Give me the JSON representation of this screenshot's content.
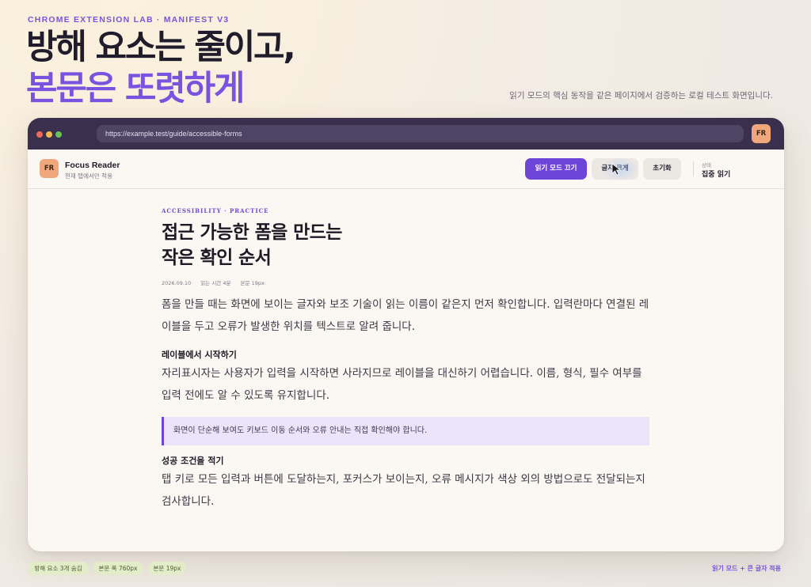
{
  "eyebrow": "CHROME EXTENSION LAB · MANIFEST V3",
  "hero": {
    "line1": "방해 요소는 줄이고,",
    "line2": "본문은 또렷하게",
    "subtitle": "읽기 모드의 핵심 동작을 같은 페이지에서 검증하는 로컬 테스트 화면입니다."
  },
  "browser": {
    "url": "https://example.test/guide/accessible-forms",
    "extension_badge": "FR"
  },
  "toolbar": {
    "logo": "FR",
    "app_name": "Focus Reader",
    "app_scope": "현재 탭에서만 적용",
    "reader_toggle_label": "읽기 모드 끄기",
    "font_size_label": "글자 크게",
    "reset_label": "초기화",
    "state_label": "상태",
    "state_value": "집중 읽기"
  },
  "article": {
    "kicker": "ACCESSIBILITY · PRACTICE",
    "title_line1": "접근 가능한 폼을 만드는",
    "title_line2": "작은 확인 순서",
    "meta": {
      "date": "2026.09.10",
      "read_time": "읽는 시간 4분",
      "font_size": "본문 19px"
    },
    "intro": "폼을 만들 때는 화면에 보이는 글자와 보조 기술이 읽는 이름이 같은지 먼저 확인합니다. 입력란마다 연결된 레이블을 두고 오류가 발생한 위치를 텍스트로 알려 줍니다.",
    "section1_heading": "레이블에서 시작하기",
    "section1_body": "자리표시자는 사용자가 입력을 시작하면 사라지므로 레이블을 대신하기 어렵습니다. 이름, 형식, 필수 여부를 입력 전에도 알 수 있도록 유지합니다.",
    "callout": "화면이 단순해 보여도 키보드 이동 순서와 오류 안내는 직접 확인해야 합니다.",
    "section2_heading": "성공 조건을 적기",
    "section2_body": "탭 키로 모든 입력과 버튼에 도달하는지, 포커스가 보이는지, 오류 메시지가 색상 외의 방법으로도 전달되는지 검사합니다."
  },
  "footer": {
    "chips": [
      "방해 요소 3개 숨김",
      "본문 폭 760px",
      "본문 19px"
    ],
    "status": "읽기 모드 + 큰 글자 적용"
  },
  "colors": {
    "accent": "#6e45d9",
    "chrome": "#3a2f4d",
    "badge": "#f0a77c",
    "chip": "#e3ecc9"
  }
}
